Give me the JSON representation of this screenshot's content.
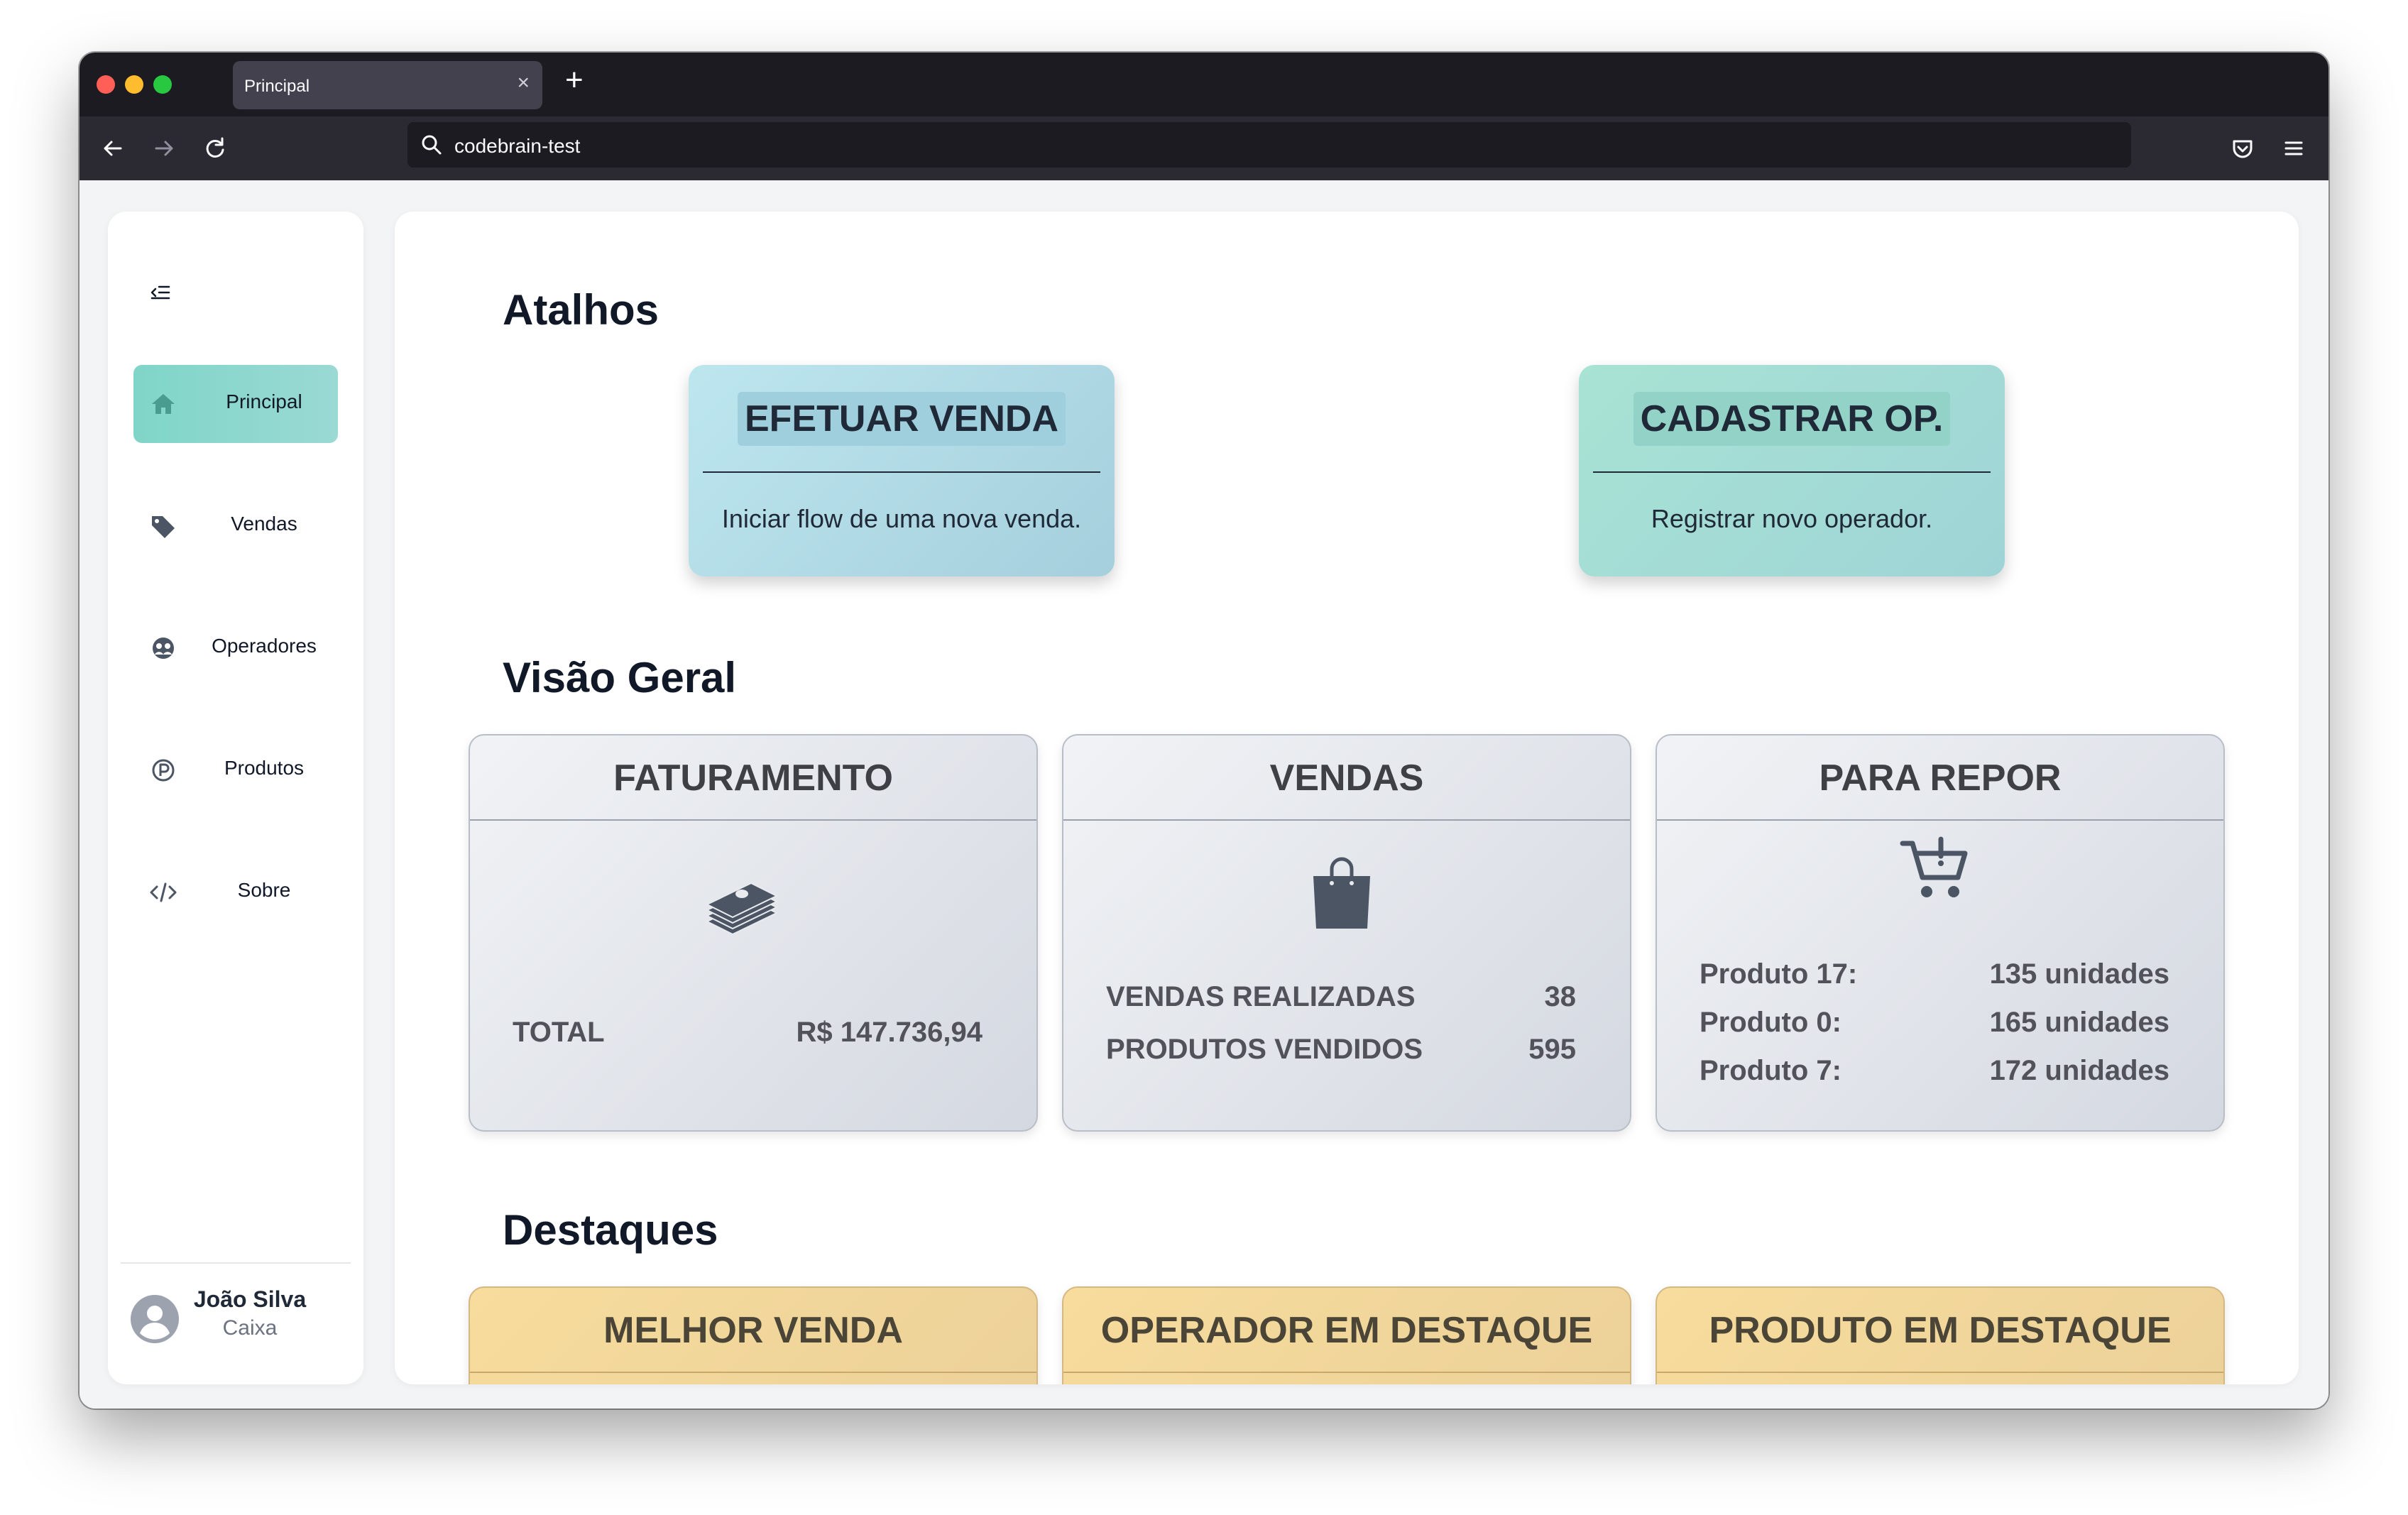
{
  "browser": {
    "tab_title": "Principal",
    "tab_close": "×",
    "new_tab": "+",
    "url": "codebrain-test"
  },
  "sidebar": {
    "items": [
      {
        "label": "Principal",
        "icon": "home-icon",
        "active": true
      },
      {
        "label": "Vendas",
        "icon": "tag-icon",
        "active": false
      },
      {
        "label": "Operadores",
        "icon": "users-icon",
        "active": false
      },
      {
        "label": "Produtos",
        "icon": "product-icon",
        "active": false
      },
      {
        "label": "Sobre",
        "icon": "code-icon",
        "active": false
      }
    ],
    "user": {
      "name": "João Silva",
      "role": "Caixa"
    }
  },
  "sections": {
    "shortcuts": "Atalhos",
    "overview": "Visão Geral",
    "highlights": "Destaques"
  },
  "shortcuts": [
    {
      "title": "EFETUAR VENDA",
      "description": "Iniciar flow de uma nova venda."
    },
    {
      "title": "CADASTRAR OP.",
      "description": "Registrar novo operador."
    }
  ],
  "overview": {
    "revenue": {
      "title": "FATURAMENTO",
      "icon": "money-stack-icon",
      "label": "TOTAL",
      "value": "R$ 147.736,94"
    },
    "sales": {
      "title": "VENDAS",
      "icon": "shopping-bag-icon",
      "rows": [
        {
          "label": "VENDAS REALIZADAS",
          "value": "38"
        },
        {
          "label": "PRODUTOS VENDIDOS",
          "value": "595"
        }
      ]
    },
    "restock": {
      "title": "PARA REPOR",
      "icon": "cart-alert-icon",
      "rows": [
        {
          "label": "Produto 17:",
          "value": "135 unidades"
        },
        {
          "label": "Produto 0:",
          "value": "165 unidades"
        },
        {
          "label": "Produto 7:",
          "value": "172 unidades"
        }
      ]
    }
  },
  "highlights": [
    {
      "title": "MELHOR VENDA"
    },
    {
      "title": "OPERADOR EM DESTAQUE"
    },
    {
      "title": "PRODUTO EM DESTAQUE"
    }
  ],
  "colors": {
    "accent": "#7fd5c8",
    "shortcut_blue": "#bde6ef",
    "shortcut_green": "#a8e3d4",
    "highlight_gold": "#f7dc9d"
  }
}
